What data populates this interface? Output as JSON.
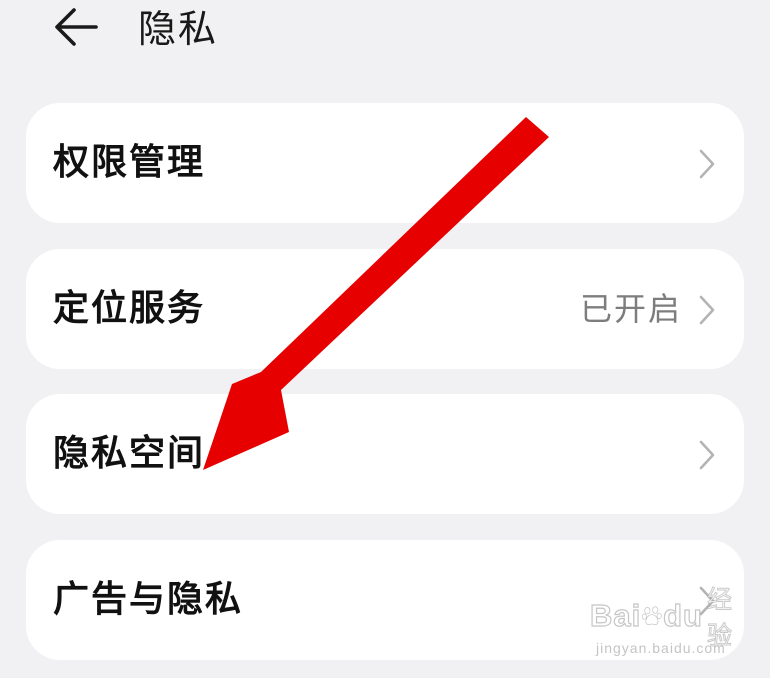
{
  "header": {
    "title": "隐私",
    "back_icon": "arrow-left-icon"
  },
  "items": [
    {
      "label": "权限管理",
      "value": ""
    },
    {
      "label": "定位服务",
      "value": "已开启"
    },
    {
      "label": "隐私空间",
      "value": ""
    },
    {
      "label": "广告与隐私",
      "value": ""
    }
  ],
  "annotation": {
    "color": "#e60000",
    "points_to": "隐私空间"
  },
  "watermark": {
    "logo_text": "Bai",
    "logo_text_2": "du",
    "logo_cn": "经验",
    "url": "jingyan.baidu.com"
  },
  "colors": {
    "background": "#f1f1f3",
    "card": "#ffffff",
    "text_primary": "#111111",
    "text_secondary": "#7d7d7d",
    "chevron": "#b4b4b4"
  }
}
